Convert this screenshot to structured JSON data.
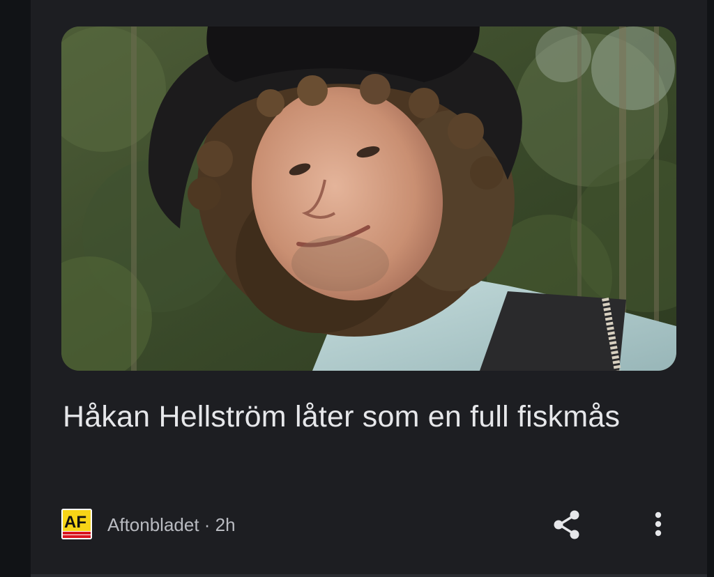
{
  "article": {
    "headline": "Håkan Hellström låter som en full fiskmås",
    "image_icon": "article-photo",
    "source": {
      "name": "Aftonbladet",
      "separator": " · ",
      "age": "2h",
      "logo_text": "AF"
    },
    "actions": {
      "share_icon": "share-icon",
      "more_icon": "more-vert-icon"
    }
  },
  "colors": {
    "background": "#111316",
    "card": "#1d1e22",
    "headline_text": "#e6e7ea",
    "meta_text": "#b9bbc1",
    "logo_yellow": "#f7d417",
    "logo_red": "#d9141f"
  }
}
